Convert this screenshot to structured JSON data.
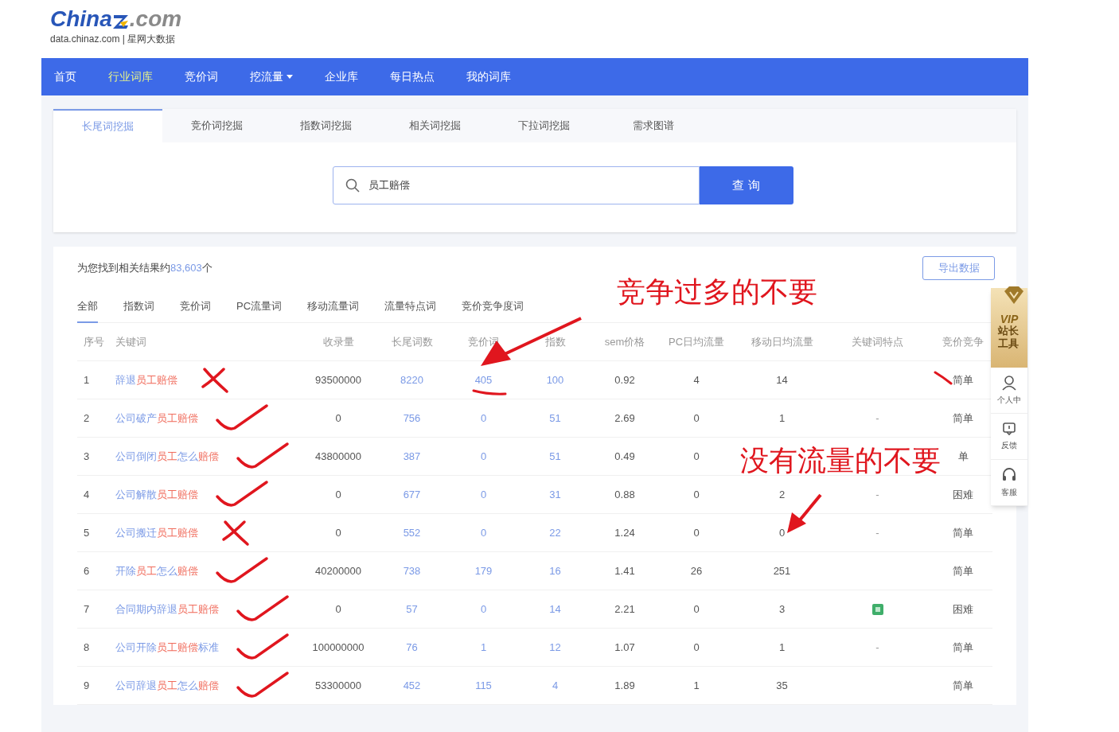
{
  "logo": {
    "brand": "China",
    "suffix": ".com",
    "tagline": "data.chinaz.com | 星网大数据"
  },
  "nav": [
    {
      "label": "首页",
      "selected": false,
      "dropdown": false
    },
    {
      "label": "行业词库",
      "selected": true,
      "dropdown": false
    },
    {
      "label": "竞价词",
      "selected": false,
      "dropdown": false
    },
    {
      "label": "挖流量",
      "selected": false,
      "dropdown": true
    },
    {
      "label": "企业库",
      "selected": false,
      "dropdown": false
    },
    {
      "label": "每日热点",
      "selected": false,
      "dropdown": false
    },
    {
      "label": "我的词库",
      "selected": false,
      "dropdown": false
    }
  ],
  "tabs": [
    {
      "label": "长尾词挖掘",
      "selected": true
    },
    {
      "label": "竞价词挖掘",
      "selected": false
    },
    {
      "label": "指数词挖掘",
      "selected": false
    },
    {
      "label": "相关词挖掘",
      "selected": false
    },
    {
      "label": "下拉词挖掘",
      "selected": false
    },
    {
      "label": "需求图谱",
      "selected": false
    }
  ],
  "search": {
    "value": "员工赔偿",
    "button": "查 询"
  },
  "results": {
    "summary": [
      {
        "text": "为您找到相关结果约",
        "hit": false
      },
      {
        "text": "83,603",
        "hit": true
      },
      {
        "text": "个",
        "hit": false
      }
    ],
    "export_button": "导出数据"
  },
  "filters": [
    {
      "label": "全部",
      "selected": true
    },
    {
      "label": "指数词",
      "selected": false
    },
    {
      "label": "竞价词",
      "selected": false
    },
    {
      "label": "PC流量词",
      "selected": false
    },
    {
      "label": "移动流量词",
      "selected": false
    },
    {
      "label": "流量特点词",
      "selected": false
    },
    {
      "label": "竞价竞争度词",
      "selected": false
    }
  ],
  "table": {
    "columns": [
      "序号",
      "关键词",
      "收录量",
      "长尾词数",
      "竞价词",
      "指数",
      "sem价格",
      "PC日均流量",
      "移动日均流量",
      "关键词特点",
      "竞价竞争"
    ],
    "rows": [
      {
        "index": "1",
        "keyword": [
          {
            "text": "辞退",
            "hit": false
          },
          {
            "text": "员工赔偿",
            "hit": true
          }
        ],
        "rejected": true,
        "indexed": "93500000",
        "longtail": "8220",
        "bid": "405",
        "score": "100",
        "sem": "0.92",
        "pc": "4",
        "mobile": "14",
        "competition": "简单"
      },
      {
        "index": "2",
        "keyword": [
          {
            "text": "公司破产",
            "hit": false
          },
          {
            "text": "员工赔偿",
            "hit": true
          }
        ],
        "rejected": false,
        "indexed": "0",
        "longtail": "756",
        "bid": "0",
        "score": "51",
        "sem": "2.69",
        "pc": "0",
        "mobile": "1",
        "feature": "-",
        "competition": "简单"
      },
      {
        "index": "3",
        "keyword": [
          {
            "text": "公司倒闭",
            "hit": false
          },
          {
            "text": "员工",
            "hit": true
          },
          {
            "text": "怎么",
            "hit": false
          },
          {
            "text": "赔偿",
            "hit": true
          }
        ],
        "rejected": false,
        "indexed": "43800000",
        "longtail": "387",
        "bid": "0",
        "score": "51",
        "sem": "0.49",
        "pc": "0",
        "competition": "单"
      },
      {
        "index": "4",
        "keyword": [
          {
            "text": "公司解散",
            "hit": false
          },
          {
            "text": "员工赔偿",
            "hit": true
          }
        ],
        "rejected": false,
        "indexed": "0",
        "longtail": "677",
        "bid": "0",
        "score": "31",
        "sem": "0.88",
        "pc": "0",
        "mobile": "2",
        "feature": "-",
        "competition": "困难"
      },
      {
        "index": "5",
        "keyword": [
          {
            "text": "公司搬迁",
            "hit": false
          },
          {
            "text": "员工赔偿",
            "hit": true
          }
        ],
        "rejected": true,
        "indexed": "0",
        "longtail": "552",
        "bid": "0",
        "score": "22",
        "sem": "1.24",
        "pc": "0",
        "mobile": "0",
        "feature": "-",
        "competition": "简单"
      },
      {
        "index": "6",
        "keyword": [
          {
            "text": "开除",
            "hit": false
          },
          {
            "text": "员工",
            "hit": true
          },
          {
            "text": "怎么",
            "hit": false
          },
          {
            "text": "赔偿",
            "hit": true
          }
        ],
        "rejected": false,
        "indexed": "40200000",
        "longtail": "738",
        "bid": "179",
        "score": "16",
        "sem": "1.41",
        "pc": "26",
        "mobile": "251",
        "competition": "简单"
      },
      {
        "index": "7",
        "keyword": [
          {
            "text": "合同期内辞退",
            "hit": false
          },
          {
            "text": "员工赔偿",
            "hit": true
          }
        ],
        "rejected": false,
        "indexed": "0",
        "longtail": "57",
        "bid": "0",
        "score": "14",
        "sem": "2.21",
        "pc": "0",
        "mobile": "3",
        "feature_icon": true,
        "competition": "困难"
      },
      {
        "index": "8",
        "keyword": [
          {
            "text": "公司开除",
            "hit": false
          },
          {
            "text": "员工赔偿",
            "hit": true
          },
          {
            "text": "标准",
            "hit": false
          }
        ],
        "rejected": false,
        "indexed": "100000000",
        "longtail": "76",
        "bid": "1",
        "score": "12",
        "sem": "1.07",
        "pc": "0",
        "mobile": "1",
        "feature": "-",
        "competition": "简单"
      },
      {
        "index": "9",
        "keyword": [
          {
            "text": "公司辞退",
            "hit": false
          },
          {
            "text": "员工",
            "hit": true
          },
          {
            "text": "怎么",
            "hit": false
          },
          {
            "text": "赔偿",
            "hit": true
          }
        ],
        "rejected": false,
        "indexed": "53300000",
        "longtail": "452",
        "bid": "115",
        "score": "4",
        "sem": "1.89",
        "pc": "1",
        "mobile": "35",
        "competition": "简单"
      }
    ]
  },
  "annotations": [
    {
      "text": "竞争过多的不要"
    },
    {
      "text": "没有流量的不要"
    }
  ],
  "float_bar": [
    {
      "kind": "vip",
      "label": "站长工具",
      "badge": "VIP"
    },
    {
      "kind": "user",
      "label": "个人中"
    },
    {
      "kind": "feedback",
      "label": "反馈"
    },
    {
      "kind": "support",
      "label": "客服"
    }
  ]
}
